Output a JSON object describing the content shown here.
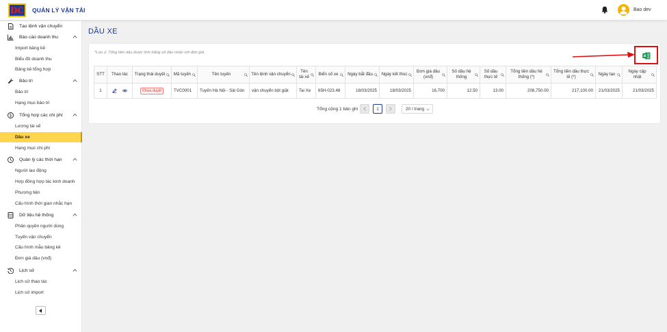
{
  "header": {
    "app_title": "QUẢN LÝ VẬN TẢI",
    "user_name": "Bao dev"
  },
  "sidebar": {
    "items": [
      {
        "type": "group",
        "label": "Tạo lệnh vận chuyển",
        "icon": "document-icon",
        "chevron": false
      },
      {
        "type": "group",
        "label": "Báo cáo doanh thu",
        "icon": "chart-icon",
        "chevron": true
      },
      {
        "type": "item",
        "label": "Import bảng kê"
      },
      {
        "type": "item",
        "label": "Biểu đồ doanh thu"
      },
      {
        "type": "item",
        "label": "Bảng kê tổng hợp"
      },
      {
        "type": "group",
        "label": "Bảo trì",
        "icon": "wrench-icon",
        "chevron": true
      },
      {
        "type": "item",
        "label": "Bảo trì"
      },
      {
        "type": "item",
        "label": "Hạng mục bảo trì"
      },
      {
        "type": "group",
        "label": "Tổng hợp các chi phí",
        "icon": "dollar-icon",
        "chevron": true
      },
      {
        "type": "item",
        "label": "Lương tài xế"
      },
      {
        "type": "item",
        "label": "Dầu xe",
        "active": true
      },
      {
        "type": "item",
        "label": "Hạng mục chi phí"
      },
      {
        "type": "group",
        "label": "Quản lý các thời hạn",
        "icon": "clock-icon",
        "chevron": true
      },
      {
        "type": "item",
        "label": "Người lao động"
      },
      {
        "type": "item",
        "label": "Hợp đồng hợp tác kinh doanh"
      },
      {
        "type": "item",
        "label": "Phương tiện"
      },
      {
        "type": "item",
        "label": "Cấu hình thời gian nhắc hạn"
      },
      {
        "type": "group",
        "label": "Dữ liệu hệ thống",
        "icon": "database-icon",
        "chevron": true
      },
      {
        "type": "item",
        "label": "Phân quyền người dùng"
      },
      {
        "type": "item",
        "label": "Tuyến vận chuyển"
      },
      {
        "type": "item",
        "label": "Cấu hình mẫu bảng kê"
      },
      {
        "type": "item",
        "label": "Đơn giá dầu (vnđ)"
      },
      {
        "type": "group",
        "label": "Lịch sử",
        "icon": "history-icon",
        "chevron": true
      },
      {
        "type": "item",
        "label": "Lịch sử thao tác"
      },
      {
        "type": "item",
        "label": "Lịch sử import"
      }
    ]
  },
  "page": {
    "title": "DẦU XE",
    "note": "*Lưu ý: Tổng tiền dầu được tính bằng số dầu nhân với đơn giá."
  },
  "table": {
    "columns": [
      {
        "label": "STT",
        "search": false
      },
      {
        "label": "Thao tác",
        "search": false
      },
      {
        "label": "Trạng thái duyệt",
        "search": true
      },
      {
        "label": "Mã tuyến",
        "search": true
      },
      {
        "label": "Tên tuyến",
        "search": true
      },
      {
        "label": "Tên lệnh vận chuyển",
        "search": true
      },
      {
        "label": "Tên tài xế",
        "search": true
      },
      {
        "label": "Biển số xe",
        "search": true
      },
      {
        "label": "Ngày bắt đầu",
        "search": true
      },
      {
        "label": "Ngày kết thúc",
        "search": true
      },
      {
        "label": "Đơn giá dầu (vnđ)",
        "search": true
      },
      {
        "label": "Số dầu hệ thống",
        "search": true
      },
      {
        "label": "Số dầu thực tế",
        "search": true
      },
      {
        "label": "Tổng tiền dầu hệ thống (*)",
        "search": true
      },
      {
        "label": "Tổng tiền dầu thực tế (*)",
        "search": true
      },
      {
        "label": "Ngày tạo",
        "search": true
      },
      {
        "label": "Ngày cập nhật",
        "search": true
      }
    ],
    "rows": [
      {
        "stt": "1",
        "status": "Chưa duyệt",
        "route_code": "TVC0001",
        "route_name": "Tuyến Hà Nội - Sài Gòn",
        "order_name": "vận chuyển bột giặt",
        "driver": "Tai Xe",
        "plate": "65H-023.48",
        "start_date": "18/03/2025",
        "end_date": "18/03/2025",
        "unit_price": "16,700",
        "sys_fuel": "12.50",
        "actual_fuel": "13.00",
        "sys_total": "208,750.00",
        "actual_total": "217,100.00",
        "created": "21/03/2025",
        "updated": "21/03/2025"
      }
    ]
  },
  "pagination": {
    "total_text": "Tổng cộng 1 bản ghi",
    "current_page": "1",
    "page_size": "20 / trang"
  },
  "colors": {
    "brand": "#1f3a93",
    "active_menu": "#ffd54f",
    "excel": "#1d6f42",
    "highlight": "#e01010"
  }
}
